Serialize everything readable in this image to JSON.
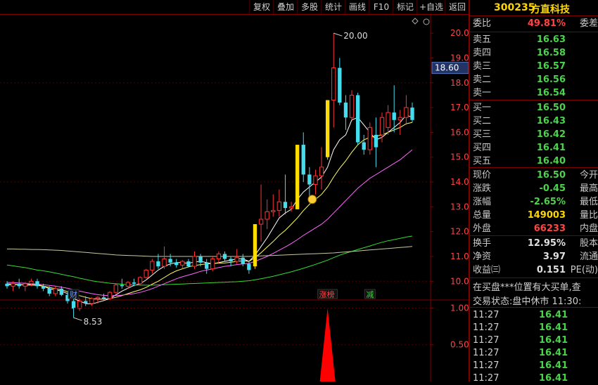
{
  "toolbar": {
    "buttons": [
      "复权",
      "叠加",
      "多股",
      "统计",
      "画线",
      "F10",
      "标记",
      "+自选",
      "返回"
    ]
  },
  "stock": {
    "code": "300235",
    "name": "方直科技"
  },
  "quote": {
    "webi_label": "委比",
    "webi_value": "49.81%",
    "wecha_label": "委差",
    "asks": [
      {
        "label": "卖五",
        "price": "16.63"
      },
      {
        "label": "卖四",
        "price": "16.58"
      },
      {
        "label": "卖三",
        "price": "16.57"
      },
      {
        "label": "卖二",
        "price": "16.56"
      },
      {
        "label": "卖一",
        "price": "16.54"
      }
    ],
    "bids": [
      {
        "label": "买一",
        "price": "16.50"
      },
      {
        "label": "买二",
        "price": "16.43"
      },
      {
        "label": "买三",
        "price": "16.42"
      },
      {
        "label": "买四",
        "price": "16.41"
      },
      {
        "label": "买五",
        "price": "16.40"
      }
    ],
    "stats": [
      {
        "label": "现价",
        "value": "16.50",
        "label2": "今开",
        "color": "green"
      },
      {
        "label": "涨跌",
        "value": "-0.45",
        "label2": "最高",
        "color": "green"
      },
      {
        "label": "涨幅",
        "value": "-2.65%",
        "label2": "最低",
        "color": "green"
      },
      {
        "label": "总量",
        "value": "149003",
        "label2": "量比",
        "color": "yellow"
      },
      {
        "label": "外盘",
        "value": "66233",
        "label2": "内盘",
        "color": "red"
      }
    ],
    "stats2": [
      {
        "label": "换手",
        "value": "12.95%",
        "label2": "股本"
      },
      {
        "label": "净资",
        "value": "3.97",
        "label2": "流通"
      },
      {
        "label": "收益㈢",
        "value": "0.151",
        "label2": "PE(动)"
      }
    ],
    "marquee": "在买盘***位置有大买单,查",
    "status": "交易状态:盘中休市 11:30:",
    "ticks": [
      {
        "time": "11:27",
        "price": "16.41"
      },
      {
        "time": "11:27",
        "price": "16.41"
      },
      {
        "time": "11:27",
        "price": "16.41"
      },
      {
        "time": "11:27",
        "price": "16.41"
      },
      {
        "time": "11:27",
        "price": "16.41"
      },
      {
        "time": "11:27",
        "price": "16.41"
      }
    ]
  },
  "chart_data": {
    "type": "candlestick",
    "price_axis": {
      "ticks": [
        "20.00",
        "19.00",
        "18.00",
        "17.00",
        "16.00",
        "15.00",
        "14.00",
        "13.00",
        "12.00",
        "11.00",
        "10.00"
      ],
      "ylim": [
        9.3,
        20.6
      ]
    },
    "current_price_label": "18.60",
    "high_annotation": "20.00",
    "low_annotation": "8.53",
    "candles": [
      {
        "o": 9.9,
        "h": 10.0,
        "l": 9.7,
        "c": 9.8
      },
      {
        "o": 9.8,
        "h": 10.0,
        "l": 9.6,
        "c": 9.9
      },
      {
        "o": 9.9,
        "h": 10.1,
        "l": 9.7,
        "c": 9.8
      },
      {
        "o": 9.8,
        "h": 9.95,
        "l": 9.6,
        "c": 9.9
      },
      {
        "o": 9.9,
        "h": 10.1,
        "l": 9.8,
        "c": 10.0
      },
      {
        "o": 10.0,
        "h": 10.1,
        "l": 9.7,
        "c": 9.8
      },
      {
        "o": 9.8,
        "h": 9.9,
        "l": 9.6,
        "c": 9.7
      },
      {
        "o": 9.7,
        "h": 9.8,
        "l": 9.4,
        "c": 9.5
      },
      {
        "o": 9.5,
        "h": 9.8,
        "l": 9.4,
        "c": 9.7
      },
      {
        "o": 9.7,
        "h": 9.8,
        "l": 9.4,
        "c": 9.45
      },
      {
        "o": 9.45,
        "h": 9.6,
        "l": 9.1,
        "c": 9.2
      },
      {
        "o": 9.2,
        "h": 9.4,
        "l": 8.53,
        "c": 8.9
      },
      {
        "o": 8.9,
        "h": 9.3,
        "l": 8.8,
        "c": 9.2
      },
      {
        "o": 9.2,
        "h": 9.4,
        "l": 9.0,
        "c": 9.1
      },
      {
        "o": 9.1,
        "h": 9.35,
        "l": 9.0,
        "c": 9.3
      },
      {
        "o": 9.3,
        "h": 9.4,
        "l": 9.1,
        "c": 9.35
      },
      {
        "o": 9.35,
        "h": 9.5,
        "l": 9.2,
        "c": 9.3
      },
      {
        "o": 9.3,
        "h": 9.6,
        "l": 9.25,
        "c": 9.55
      },
      {
        "o": 9.55,
        "h": 9.9,
        "l": 9.5,
        "c": 9.85
      },
      {
        "o": 9.85,
        "h": 10.1,
        "l": 9.7,
        "c": 9.8
      },
      {
        "o": 9.8,
        "h": 10.0,
        "l": 9.7,
        "c": 9.95
      },
      {
        "o": 9.95,
        "h": 10.1,
        "l": 9.8,
        "c": 9.9
      },
      {
        "o": 9.9,
        "h": 10.2,
        "l": 9.85,
        "c": 10.15
      },
      {
        "o": 10.15,
        "h": 10.5,
        "l": 10.1,
        "c": 10.45
      },
      {
        "o": 10.45,
        "h": 10.9,
        "l": 10.3,
        "c": 10.8
      },
      {
        "o": 10.8,
        "h": 11.1,
        "l": 10.5,
        "c": 10.6
      },
      {
        "o": 10.6,
        "h": 11.4,
        "l": 10.5,
        "c": 10.9
      },
      {
        "o": 10.9,
        "h": 11.1,
        "l": 10.6,
        "c": 10.75
      },
      {
        "o": 10.75,
        "h": 10.9,
        "l": 10.55,
        "c": 10.65
      },
      {
        "o": 10.65,
        "h": 10.85,
        "l": 10.5,
        "c": 10.8
      },
      {
        "o": 10.8,
        "h": 10.9,
        "l": 10.55,
        "c": 10.6
      },
      {
        "o": 10.6,
        "h": 11.2,
        "l": 10.5,
        "c": 11.0
      },
      {
        "o": 11.0,
        "h": 11.1,
        "l": 10.6,
        "c": 10.75
      },
      {
        "o": 10.75,
        "h": 10.9,
        "l": 10.3,
        "c": 10.5
      },
      {
        "o": 10.5,
        "h": 11.0,
        "l": 10.4,
        "c": 10.9
      },
      {
        "o": 10.9,
        "h": 11.2,
        "l": 10.7,
        "c": 11.1
      },
      {
        "o": 11.1,
        "h": 11.2,
        "l": 10.8,
        "c": 10.9
      },
      {
        "o": 10.9,
        "h": 11.0,
        "l": 10.6,
        "c": 10.8
      },
      {
        "o": 10.8,
        "h": 11.3,
        "l": 10.7,
        "c": 10.95
      },
      {
        "o": 10.95,
        "h": 11.1,
        "l": 10.6,
        "c": 10.7
      },
      {
        "o": 10.7,
        "h": 10.8,
        "l": 10.3,
        "c": 10.45
      },
      {
        "o": 10.6,
        "h": 12.3,
        "l": 10.5,
        "c": 12.3
      },
      {
        "o": 12.3,
        "h": 13.9,
        "l": 11.6,
        "c": 12.5
      },
      {
        "o": 12.5,
        "h": 13.3,
        "l": 12.1,
        "c": 12.8
      },
      {
        "o": 12.8,
        "h": 13.5,
        "l": 12.6,
        "c": 12.85
      },
      {
        "o": 12.85,
        "h": 13.7,
        "l": 12.6,
        "c": 13.2
      },
      {
        "o": 13.2,
        "h": 14.3,
        "l": 12.7,
        "c": 12.95
      },
      {
        "o": 12.95,
        "h": 13.2,
        "l": 12.8,
        "c": 13.0
      },
      {
        "o": 12.9,
        "h": 15.5,
        "l": 12.9,
        "c": 15.5
      },
      {
        "o": 15.5,
        "h": 16.0,
        "l": 14.0,
        "c": 14.3
      },
      {
        "o": 14.3,
        "h": 14.6,
        "l": 13.3,
        "c": 13.9
      },
      {
        "o": 13.9,
        "h": 14.5,
        "l": 13.5,
        "c": 14.25
      },
      {
        "o": 14.25,
        "h": 15.4,
        "l": 13.7,
        "c": 14.6
      },
      {
        "o": 15.0,
        "h": 17.3,
        "l": 14.9,
        "c": 17.3
      },
      {
        "o": 17.3,
        "h": 20.0,
        "l": 16.2,
        "c": 18.6
      },
      {
        "o": 18.6,
        "h": 19.0,
        "l": 17.1,
        "c": 17.2
      },
      {
        "o": 17.2,
        "h": 17.5,
        "l": 16.1,
        "c": 16.6
      },
      {
        "o": 16.6,
        "h": 17.7,
        "l": 16.5,
        "c": 17.5
      },
      {
        "o": 17.5,
        "h": 17.6,
        "l": 15.5,
        "c": 15.6
      },
      {
        "o": 15.6,
        "h": 15.9,
        "l": 15.1,
        "c": 15.3
      },
      {
        "o": 15.3,
        "h": 16.4,
        "l": 15.1,
        "c": 16.2
      },
      {
        "o": 15.9,
        "h": 16.6,
        "l": 14.6,
        "c": 15.4
      },
      {
        "o": 15.9,
        "h": 16.8,
        "l": 15.6,
        "c": 16.6
      },
      {
        "o": 16.2,
        "h": 17.1,
        "l": 15.9,
        "c": 16.8
      },
      {
        "o": 16.8,
        "h": 17.9,
        "l": 16.0,
        "c": 16.5
      },
      {
        "o": 16.5,
        "h": 16.9,
        "l": 15.9,
        "c": 16.6
      },
      {
        "o": 16.6,
        "h": 17.5,
        "l": 16.3,
        "c": 17.0
      },
      {
        "o": 17.0,
        "h": 17.2,
        "l": 16.4,
        "c": 16.5
      }
    ],
    "limit_up_candles": [
      41,
      48,
      53
    ],
    "ma_series": [
      {
        "color": "#ffffff",
        "values": [
          9.85,
          9.87,
          9.86,
          9.85,
          9.88,
          9.87,
          9.8,
          9.7,
          9.65,
          9.6,
          9.5,
          9.3,
          9.2,
          9.1,
          9.08,
          9.15,
          9.22,
          9.3,
          9.45,
          9.6,
          9.72,
          9.83,
          9.9,
          10.05,
          10.25,
          10.45,
          10.6,
          10.7,
          10.75,
          10.75,
          10.72,
          10.78,
          10.8,
          10.75,
          10.7,
          10.75,
          10.8,
          10.85,
          10.9,
          10.9,
          10.8,
          11.05,
          11.4,
          11.75,
          12.15,
          12.55,
          12.75,
          12.9,
          13.3,
          13.6,
          13.8,
          14.0,
          14.2,
          14.6,
          15.3,
          15.7,
          15.9,
          16.5,
          16.6,
          16.3,
          16.0,
          15.7,
          15.8,
          16.0,
          16.2,
          16.4,
          16.7,
          16.6
        ]
      },
      {
        "color": "#ffff66",
        "values": [
          9.9,
          9.88,
          9.87,
          9.85,
          9.84,
          9.83,
          9.8,
          9.75,
          9.7,
          9.65,
          9.58,
          9.5,
          9.42,
          9.35,
          9.3,
          9.28,
          9.28,
          9.3,
          9.35,
          9.42,
          9.5,
          9.58,
          9.65,
          9.75,
          9.88,
          10.0,
          10.15,
          10.3,
          10.42,
          10.5,
          10.58,
          10.63,
          10.67,
          10.7,
          10.72,
          10.73,
          10.74,
          10.76,
          10.8,
          10.82,
          10.8,
          10.95,
          11.15,
          11.38,
          11.6,
          11.85,
          12.05,
          12.3,
          12.55,
          12.85,
          13.1,
          13.3,
          13.5,
          13.8,
          14.2,
          14.55,
          14.85,
          15.2,
          15.5,
          15.7,
          15.8,
          15.85,
          15.9,
          16.0,
          16.1,
          16.2,
          16.35,
          16.4
        ]
      },
      {
        "color": "#ff66ff",
        "values": [
          9.95,
          9.94,
          9.93,
          9.92,
          9.9,
          9.88,
          9.86,
          9.83,
          9.8,
          9.76,
          9.72,
          9.66,
          9.6,
          9.55,
          9.5,
          9.46,
          9.43,
          9.42,
          9.42,
          9.44,
          9.47,
          9.5,
          9.55,
          9.62,
          9.7,
          9.8,
          9.9,
          10.0,
          10.1,
          10.18,
          10.25,
          10.32,
          10.4,
          10.45,
          10.5,
          10.55,
          10.6,
          10.63,
          10.67,
          10.7,
          10.72,
          10.8,
          10.9,
          11.0,
          11.12,
          11.25,
          11.38,
          11.52,
          11.68,
          11.85,
          12.0,
          12.15,
          12.3,
          12.5,
          12.75,
          13.0,
          13.25,
          13.5,
          13.75,
          13.95,
          14.15,
          14.3,
          14.45,
          14.6,
          14.75,
          14.9,
          15.1,
          15.3
        ]
      },
      {
        "color": "#33dd33",
        "values": [
          10.65,
          10.62,
          10.58,
          10.55,
          10.5,
          10.45,
          10.42,
          10.38,
          10.33,
          10.28,
          10.23,
          10.18,
          10.12,
          10.07,
          10.02,
          9.98,
          9.95,
          9.92,
          9.9,
          9.88,
          9.86,
          9.85,
          9.84,
          9.84,
          9.84,
          9.85,
          9.86,
          9.87,
          9.88,
          9.89,
          9.9,
          9.91,
          9.92,
          9.93,
          9.94,
          9.95,
          9.96,
          9.97,
          9.98,
          10.0,
          10.02,
          10.06,
          10.1,
          10.15,
          10.2,
          10.26,
          10.32,
          10.38,
          10.45,
          10.52,
          10.6,
          10.68,
          10.76,
          10.85,
          10.95,
          11.05,
          11.13,
          11.2,
          11.28,
          11.35,
          11.42,
          11.5,
          11.57,
          11.63,
          11.68,
          11.73,
          11.78,
          11.82
        ]
      },
      {
        "color": "#c8c8a0",
        "values": [
          11.3,
          11.3,
          11.29,
          11.29,
          11.28,
          11.28,
          11.27,
          11.26,
          11.25,
          11.24,
          11.22,
          11.2,
          11.18,
          11.16,
          11.14,
          11.12,
          11.1,
          11.08,
          11.06,
          11.05,
          11.04,
          11.03,
          11.02,
          11.01,
          11.0,
          11.0,
          11.0,
          11.0,
          11.0,
          11.0,
          11.0,
          11.0,
          11.0,
          11.0,
          11.0,
          11.0,
          11.0,
          11.0,
          11.0,
          11.0,
          11.0,
          11.01,
          11.02,
          11.03,
          11.04,
          11.05,
          11.06,
          11.07,
          11.08,
          11.09,
          11.1,
          11.11,
          11.12,
          11.13,
          11.14,
          11.16,
          11.18,
          11.2,
          11.22,
          11.24,
          11.26,
          11.28,
          11.3,
          11.32,
          11.34,
          11.36,
          11.38,
          11.4
        ]
      }
    ],
    "markers": [
      {
        "label": "财",
        "candle": 11,
        "color": "#6699ff"
      },
      {
        "label": "涨榜",
        "candle": 53,
        "color": "#ff4444"
      },
      {
        "label": "减",
        "candle": 60,
        "color": "#33dd33"
      }
    ],
    "indicator": {
      "ticks": [
        "1.00",
        "0.50"
      ],
      "ylim": [
        0,
        1.1
      ],
      "spike_candle": 53,
      "spike_value": 1.0
    }
  }
}
